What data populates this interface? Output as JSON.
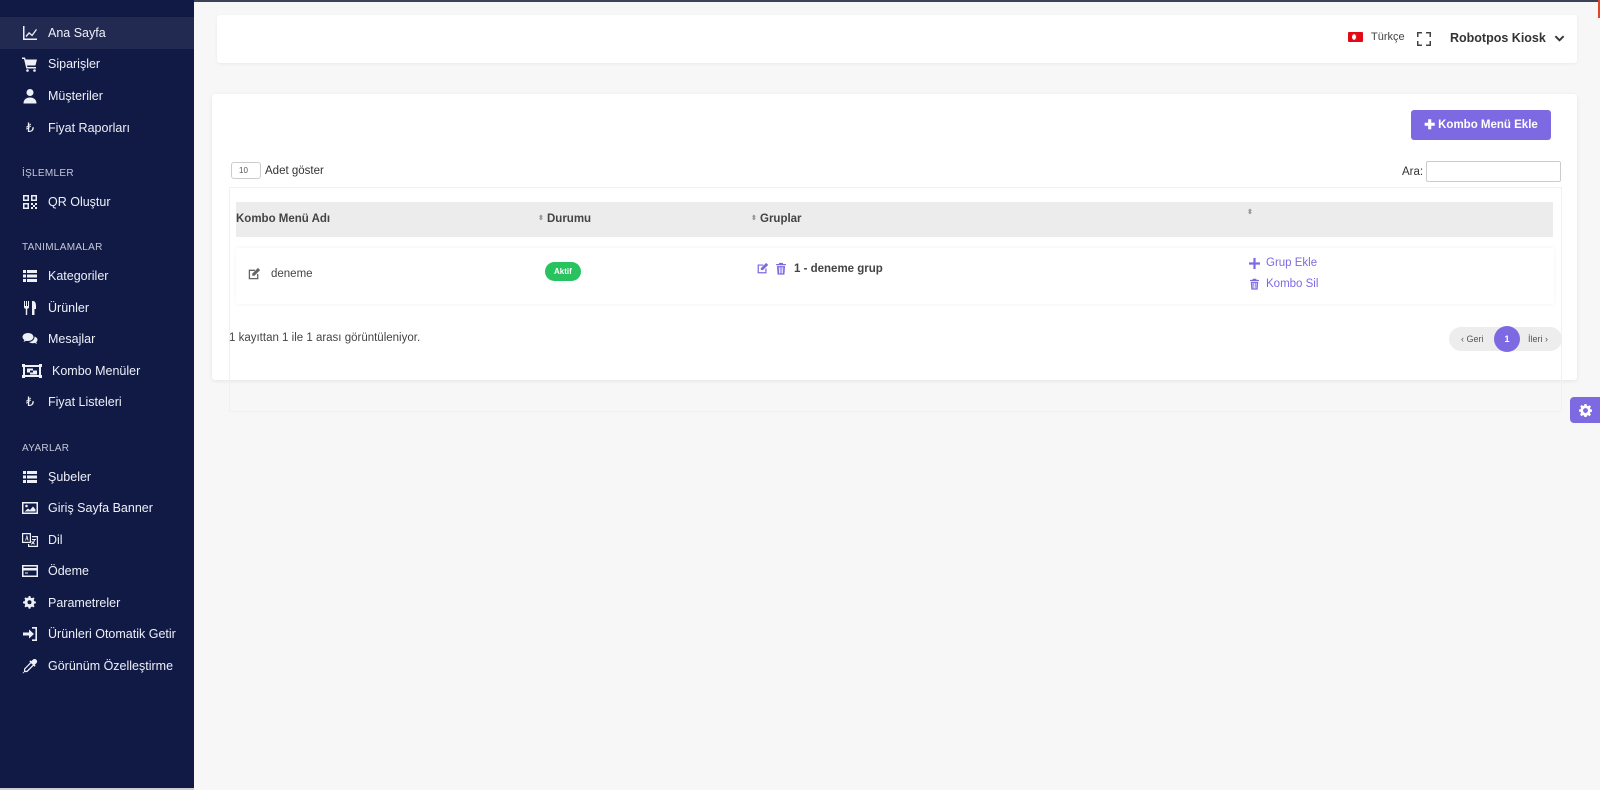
{
  "sidebar": {
    "items_top": [
      {
        "label": "Ana Sayfa",
        "icon": "chart-line-icon"
      },
      {
        "label": "Siparişler",
        "icon": "cart-icon"
      },
      {
        "label": "Müşteriler",
        "icon": "user-icon"
      },
      {
        "label": "Fiyat Raporları",
        "icon": "lira-icon"
      }
    ],
    "section_islemler": "İŞLEMLER",
    "items_islemler": [
      {
        "label": "QR Oluştur",
        "icon": "qrcode-icon"
      }
    ],
    "section_tanimlamalar": "TANIMLAMALAR",
    "items_tanimlamalar": [
      {
        "label": "Kategoriler",
        "icon": "list-icon"
      },
      {
        "label": "Ürünler",
        "icon": "utensils-icon"
      },
      {
        "label": "Mesajlar",
        "icon": "comments-icon"
      },
      {
        "label": "Kombo Menüler",
        "icon": "object-group-icon"
      },
      {
        "label": "Fiyat Listeleri",
        "icon": "lira-icon"
      }
    ],
    "section_ayarlar": "AYARLAR",
    "items_ayarlar": [
      {
        "label": "Şubeler",
        "icon": "list-icon"
      },
      {
        "label": "Giriş Sayfa Banner",
        "icon": "image-icon"
      },
      {
        "label": "Dil",
        "icon": "language-icon"
      },
      {
        "label": "Ödeme",
        "icon": "credit-card-icon"
      },
      {
        "label": "Parametreler",
        "icon": "cogs-icon"
      },
      {
        "label": "Ürünleri Otomatik Getir",
        "icon": "sign-in-icon"
      },
      {
        "label": "Görünüm Özelleştirme",
        "icon": "eyedropper-icon"
      }
    ]
  },
  "header": {
    "language": "Türkçe",
    "user": "Robotpos Kiosk"
  },
  "page": {
    "add_button": "Kombo Menü Ekle",
    "length_value": "10",
    "length_label": "Adet göster",
    "search_label": "Ara:",
    "search_value": "",
    "columns": [
      "Kombo Menü Adı",
      "Durumu",
      "Gruplar",
      ""
    ],
    "rows": [
      {
        "name": "deneme",
        "status": "Aktif",
        "group": "1 - deneme grup",
        "action_add_group": "Grup Ekle",
        "action_delete": "Kombo Sil"
      }
    ],
    "info": "1 kayıttan 1 ile 1 arası görüntüleniyor.",
    "pager": {
      "prev": "Geri",
      "current": "1",
      "next": "İleri"
    }
  },
  "colors": {
    "sidebar": "#111a45",
    "accent": "#7d6ae3",
    "active_badge": "#28c25f"
  }
}
